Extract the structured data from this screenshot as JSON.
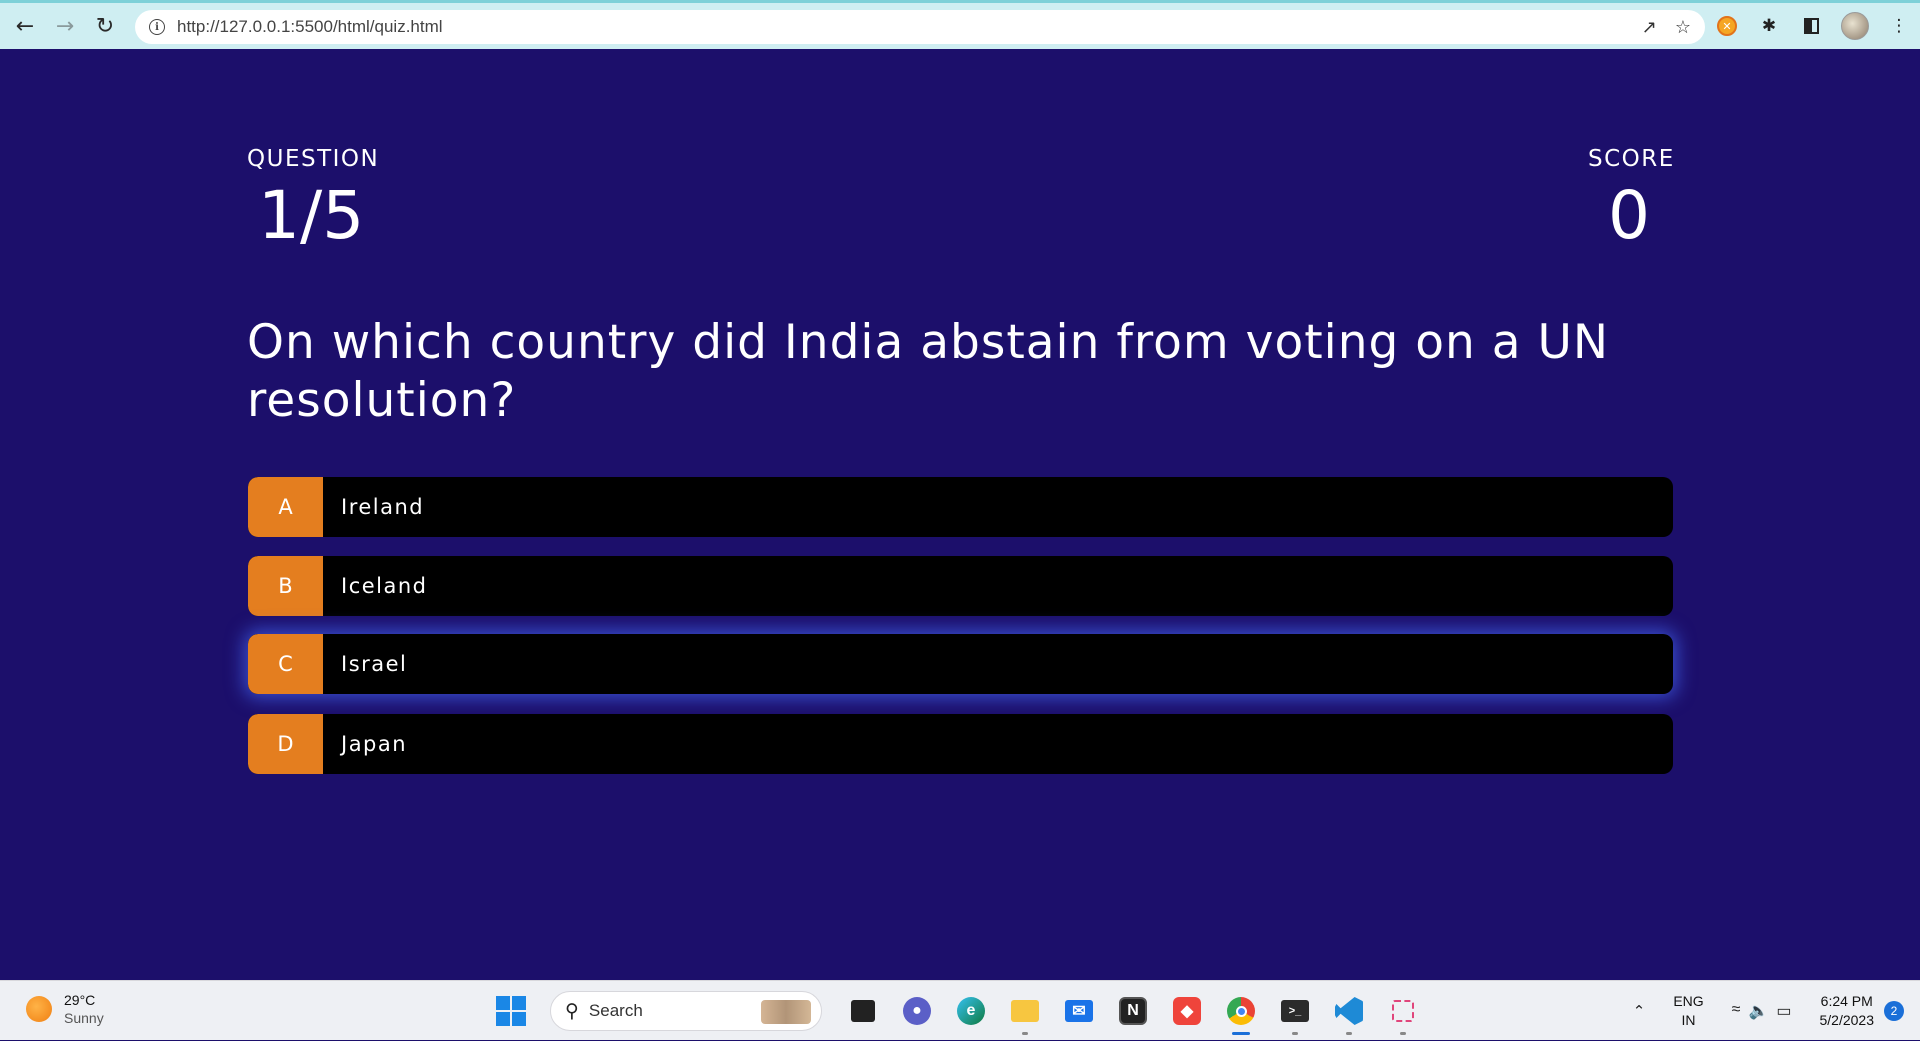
{
  "browser": {
    "url": "http://127.0.0.1:5500/html/quiz.html",
    "back_icon": "arrow-left-icon",
    "forward_icon": "arrow-right-icon",
    "reload_icon": "reload-icon"
  },
  "quiz": {
    "question_label": "QUESTION",
    "question_progress": "1/5",
    "score_label": "SCORE",
    "score_value": "0",
    "question_text": "On which country did India abstain from voting on a UN resolution?",
    "choices": [
      {
        "prefix": "A",
        "text": "Ireland"
      },
      {
        "prefix": "B",
        "text": "Iceland"
      },
      {
        "prefix": "C",
        "text": "Israel"
      },
      {
        "prefix": "D",
        "text": "Japan"
      }
    ],
    "colors": {
      "background": "#1c0f6b",
      "choice_prefix": "#e47e1f",
      "choice_body": "#000000",
      "hover_glow": "#466eff"
    }
  },
  "taskbar": {
    "weather_temp": "29°C",
    "weather_condition": "Sunny",
    "search_placeholder": "Search",
    "language_line1": "ENG",
    "language_line2": "IN",
    "time": "6:24 PM",
    "date": "5/2/2023",
    "notification_count": "2"
  }
}
